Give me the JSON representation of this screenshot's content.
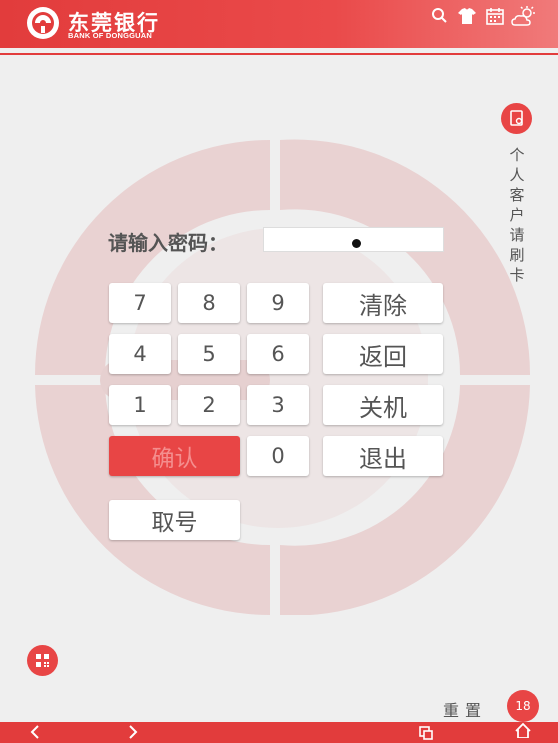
{
  "header": {
    "bank_name_cn": "东莞银行",
    "bank_name_en": "BANK OF DONGGUAN",
    "icons": [
      "search-icon",
      "shirt-icon",
      "calendar-icon",
      "weather-icon"
    ]
  },
  "side": {
    "card_icon": "card-reader-icon",
    "personal_card_text": "个人客户请刷卡"
  },
  "password": {
    "label": "请输入密码：",
    "masked": "●"
  },
  "keypad": {
    "digits": [
      "7",
      "8",
      "9",
      "4",
      "5",
      "6",
      "1",
      "2",
      "3",
      "0"
    ],
    "clear": "清除",
    "back": "返回",
    "shutdown": "关机",
    "confirm": "确认",
    "exit": "退出",
    "take_ticket": "取号"
  },
  "footer": {
    "qr_icon": "qr-code-icon",
    "reset": "重置",
    "counter": "18"
  },
  "navbar": {
    "icons": [
      "back-arrow-icon",
      "forward-arrow-icon",
      "window-icon",
      "home-icon"
    ]
  },
  "colors": {
    "brand_red": "#e23c3c",
    "button_red": "#e84545",
    "background": "#efefef"
  }
}
